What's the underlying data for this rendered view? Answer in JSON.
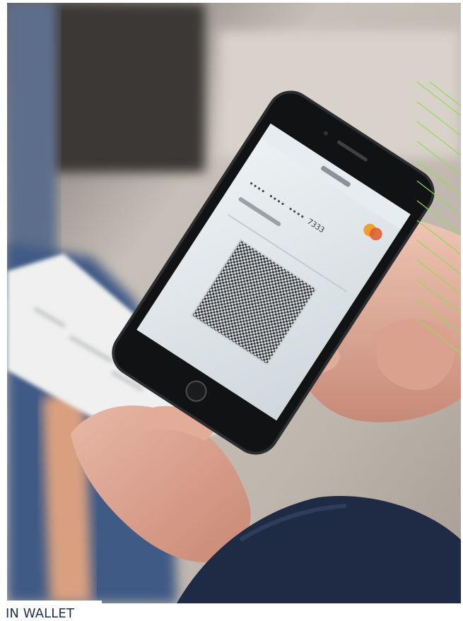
{
  "caption": {
    "text": "IN WALLET",
    "color": "#203050"
  },
  "photo": {
    "description_icon": "phone-qr-payment-photo",
    "accent_color": "#8fdc57"
  },
  "phone_screen": {
    "brand_badge": "card-brand-icon",
    "card_number": "•••• •••• •••• 7333"
  }
}
